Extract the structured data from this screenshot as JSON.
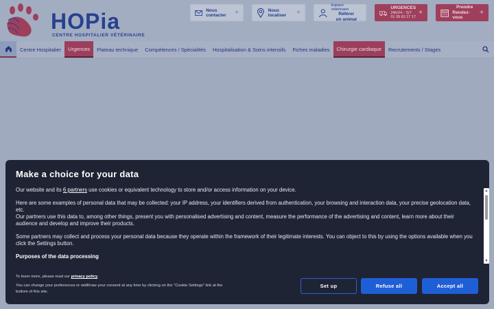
{
  "header": {
    "logo": {
      "name": "HOPia",
      "subtitle": "CENTRE HOSPITALIER VÉTÉRINAIRE"
    },
    "contact_label": "Nous contacter",
    "locate_label": "Nous localiser",
    "vet_space": {
      "line1": "Espace vétérinaire",
      "line2": "Référer",
      "line3": "un animal"
    },
    "urgences": {
      "title": "URGENCES",
      "hours": "24h/24 - 7j/7",
      "phone": "01 39 63 17 17"
    },
    "rdv": {
      "line1": "Prendre",
      "line2": "Rendez-vous"
    },
    "plus": "+"
  },
  "nav": {
    "items": [
      {
        "label": "Centre Hospitalier"
      },
      {
        "label": "Urgences"
      },
      {
        "label": "Plateau technique"
      },
      {
        "label": "Compétences / Spécialités"
      },
      {
        "label": "Hospitalisation & Soins intensifs"
      },
      {
        "label": "Fiches maladies"
      },
      {
        "label": "Chirurgie cardiaque"
      },
      {
        "label": "Recrutements / Stages"
      }
    ]
  },
  "consent": {
    "title": "Make a choice for your data",
    "p1_before": "Our website and its ",
    "p1_link": "6 partners",
    "p1_after": " use cookies or equivalent technology to store and/or access information on your device.",
    "p2": "Here are some examples of personal data that may be collected: your IP address, your identifiers derived from authentication, your browsing and interaction data, your precise geolocation data, etc.",
    "p3": "Our partners use this data to, among other things, present you with personalised advertising and content, measure the performance of the advertising and content, learn more about their audience and develop and improve their products.",
    "p4": "Some partners may collect and process your personal data because they operate within the framework of their legitimate interests. You can object to this by using the options available when you click the Settings button.",
    "purposes_heading": "Purposes of the data processing",
    "learn_more": "To learn more, please read our ",
    "privacy_link": "privacy policy",
    "change_prefs": "You can change your preferences or widthraw your consent at any time by clicking on the \"Cookie Settings\" link at the bottom of this site.",
    "setup_label": "Set up",
    "refuse_label": "Refuse all",
    "accept_label": "Accept all"
  },
  "colors": {
    "brand_blue": "#27418f",
    "brand_red": "#9e3f5c",
    "button_blue": "#1f5fd6",
    "modal_bg": "#1f2435"
  }
}
